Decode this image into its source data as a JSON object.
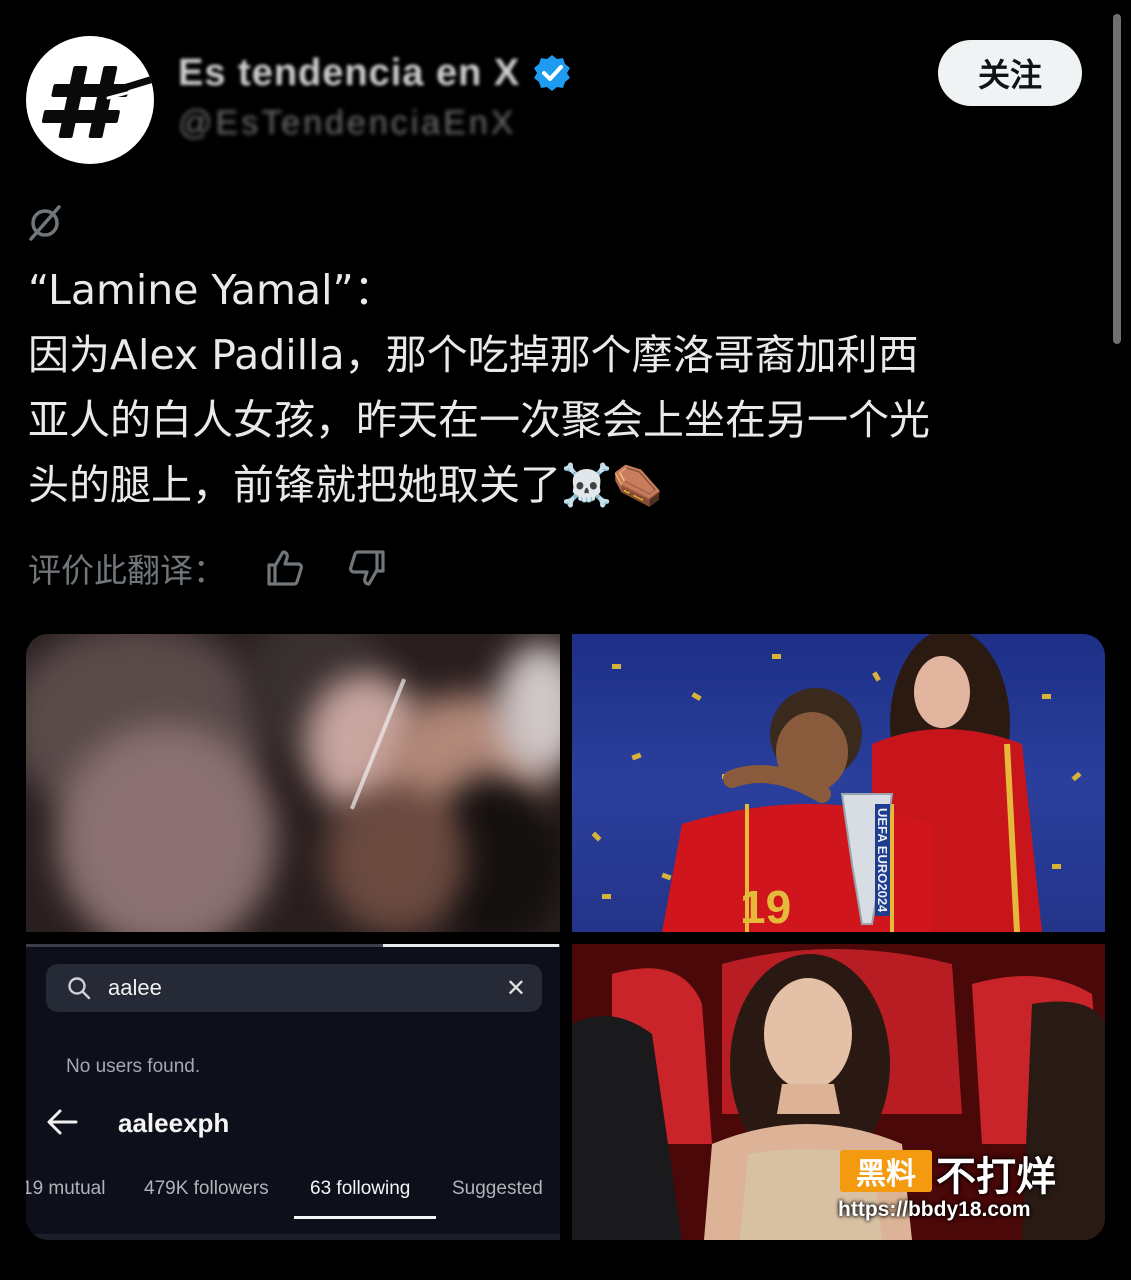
{
  "header": {
    "display_name": "Es tendencia en X",
    "handle": "@EsTendenciaEnX",
    "verified_badge_icon": "verified-badge-icon",
    "follow_label": "关注",
    "avatar_icon": "hashtag-icon"
  },
  "post": {
    "translate_icon": "translate-icon",
    "title": "“Lamine Yamal”：",
    "body_line1": "因为Alex Padilla，那个吃掉那个摩洛哥裔加利西",
    "body_line2": "亚人的白人女孩，昨天在一次聚会上坐在另一个光",
    "body_line3": "头的腿上，前锋就把她取关了☠️⚰️",
    "rate_label": "评价此翻译："
  },
  "media": {
    "video_still": "blurred-party-photo",
    "instagram": {
      "search_value": "aalee",
      "empty_text": "No users found.",
      "username": "aaleexph",
      "tabs": [
        {
          "label": "19 mutual"
        },
        {
          "label": "479K followers"
        },
        {
          "label": "63 following"
        },
        {
          "label": "Suggested"
        }
      ],
      "active_tab": "63 following"
    },
    "celebration": {
      "jersey_number": "19",
      "sash_text": "UEFA EURO2024"
    },
    "portrait": {
      "watermark_box": "黑料",
      "watermark_text": "不打烊",
      "watermark_url": "https://bbdy18.com"
    }
  },
  "colors": {
    "background": "#000000",
    "text": "#e7e9ea",
    "muted": "#71767b",
    "verified": "#1d9bf0",
    "follow_bg": "#eff3f4"
  }
}
